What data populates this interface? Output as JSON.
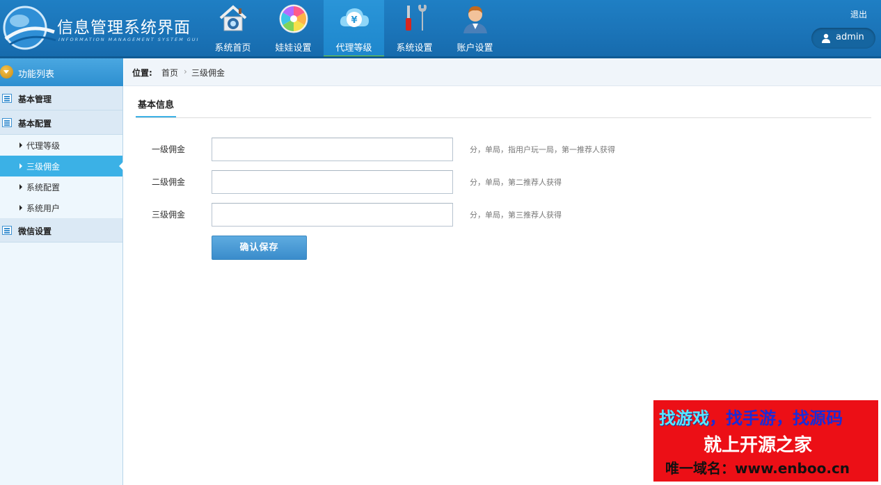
{
  "header": {
    "logo_title": "信息管理系统界面",
    "logo_subtitle": "INFORMATION MANAGEMENT SYSTEM GUI",
    "nav": [
      {
        "label": "系统首页",
        "icon": "home-icon",
        "active": false
      },
      {
        "label": "娃娃设置",
        "icon": "color-wheel-icon",
        "active": false
      },
      {
        "label": "代理等级",
        "icon": "yen-cloud-icon",
        "active": true
      },
      {
        "label": "系统设置",
        "icon": "tools-icon",
        "active": false
      },
      {
        "label": "账户设置",
        "icon": "user-account-icon",
        "active": false
      }
    ],
    "logout": "退出",
    "username": "admin",
    "accent_color": "#7ed321"
  },
  "sidebar": {
    "title": "功能列表",
    "groups": [
      {
        "label": "基本管理"
      },
      {
        "label": "基本配置"
      },
      {
        "label": "微信设置"
      }
    ],
    "items": [
      {
        "label": "代理等级",
        "active": false
      },
      {
        "label": "三级佣金",
        "active": true
      },
      {
        "label": "系统配置",
        "active": false
      },
      {
        "label": "系统用户",
        "active": false
      }
    ]
  },
  "breadcrumb": {
    "label": "位置:",
    "home": "首页",
    "separator": "›",
    "current": "三级佣金"
  },
  "main": {
    "tab": "基本信息",
    "fields": [
      {
        "label": "一级佣金",
        "value": "",
        "hint": "分，单局，指用户玩一局，第一推荐人获得"
      },
      {
        "label": "二级佣金",
        "value": "",
        "hint": "分，单局，第二推荐人获得"
      },
      {
        "label": "三级佣金",
        "value": "",
        "hint": "分，单局，第三推荐人获得"
      }
    ],
    "save_label": "确认保存"
  },
  "ad": {
    "line1_a": "找游戏",
    "line1_b": "，找手游，找源码",
    "line2": "就上开源之家",
    "line3": "唯一域名：www.enboo.cn"
  }
}
